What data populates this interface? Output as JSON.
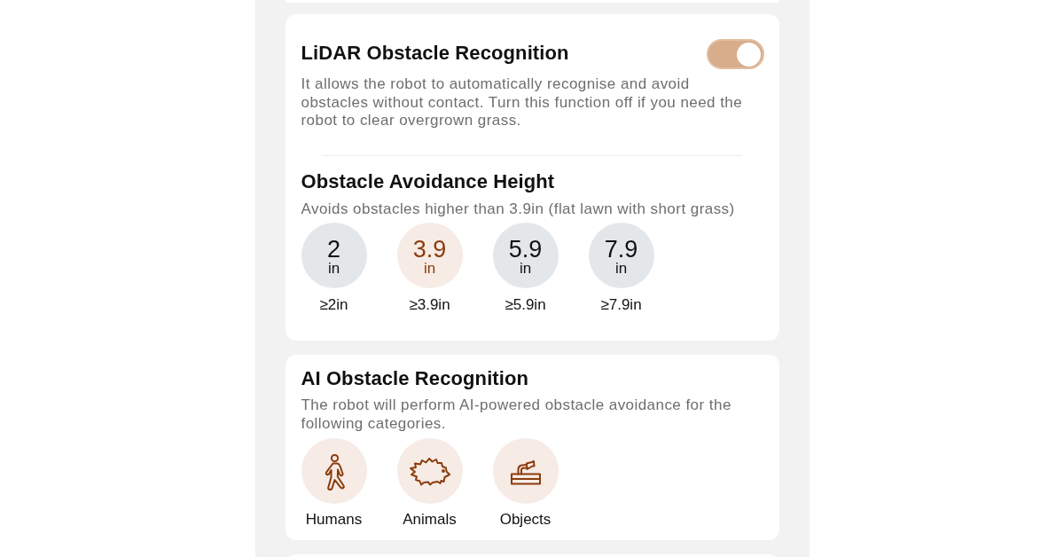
{
  "lidar_obstacle_recognition": {
    "title": "LiDAR Obstacle Recognition",
    "enabled": true,
    "description": "It allows the robot to automatically recognise and avoid obstacles without contact. Turn this function off if you need the robot to clear overgrown grass."
  },
  "obstacle_avoidance_height": {
    "title": "Obstacle Avoidance Height",
    "description": "Avoids obstacles higher than 3.9in (flat lawn with short grass)",
    "options": [
      {
        "value": "2",
        "unit": "in",
        "label": "≥2in",
        "selected": false
      },
      {
        "value": "3.9",
        "unit": "in",
        "label": "≥3.9in",
        "selected": true
      },
      {
        "value": "5.9",
        "unit": "in",
        "label": "≥5.9in",
        "selected": false
      },
      {
        "value": "7.9",
        "unit": "in",
        "label": "≥7.9in",
        "selected": false
      }
    ]
  },
  "ai_obstacle_recognition": {
    "title": "AI Obstacle Recognition",
    "description": "The robot will perform AI-powered obstacle avoidance for the following categories.",
    "categories": [
      {
        "kind": "human",
        "label": "Humans",
        "selected": true
      },
      {
        "kind": "animal",
        "label": "Animals",
        "selected": true
      },
      {
        "kind": "object",
        "label": "Objects",
        "selected": true
      }
    ]
  }
}
